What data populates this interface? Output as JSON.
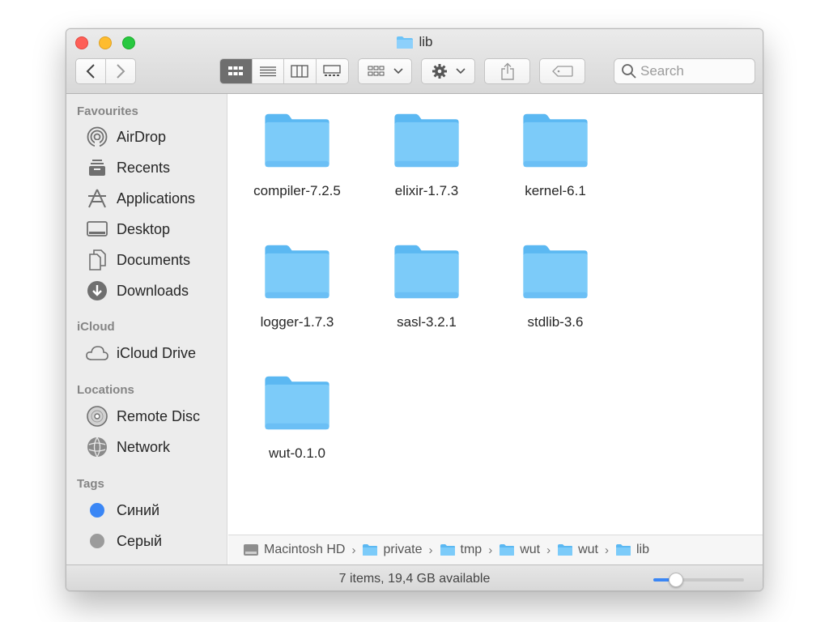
{
  "window": {
    "title": "lib"
  },
  "toolbar": {
    "search_placeholder": "Search"
  },
  "sidebar": {
    "sections": [
      {
        "title": "Favourites",
        "items": [
          {
            "label": "AirDrop",
            "icon": "airdrop-icon"
          },
          {
            "label": "Recents",
            "icon": "recents-icon"
          },
          {
            "label": "Applications",
            "icon": "applications-icon"
          },
          {
            "label": "Desktop",
            "icon": "desktop-icon"
          },
          {
            "label": "Documents",
            "icon": "documents-icon"
          },
          {
            "label": "Downloads",
            "icon": "downloads-icon"
          }
        ]
      },
      {
        "title": "iCloud",
        "items": [
          {
            "label": "iCloud Drive",
            "icon": "cloud-icon"
          }
        ]
      },
      {
        "title": "Locations",
        "items": [
          {
            "label": "Remote Disc",
            "icon": "disc-icon"
          },
          {
            "label": "Network",
            "icon": "network-icon"
          }
        ]
      },
      {
        "title": "Tags",
        "items": [
          {
            "label": "Синий",
            "color": "#3a86f5"
          },
          {
            "label": "Серый",
            "color": "#9b9b9b"
          }
        ]
      }
    ]
  },
  "files": [
    {
      "name": "compiler-7.2.5"
    },
    {
      "name": "elixir-1.7.3"
    },
    {
      "name": "kernel-6.1"
    },
    {
      "name": "logger-1.7.3"
    },
    {
      "name": "sasl-3.2.1"
    },
    {
      "name": "stdlib-3.6"
    },
    {
      "name": "wut-0.1.0"
    }
  ],
  "pathbar": {
    "crumbs": [
      "Macintosh HD",
      "private",
      "tmp",
      "wut",
      "wut",
      "lib"
    ]
  },
  "status": {
    "text": "7 items, 19,4 GB available",
    "icon_size_fraction": 0.25
  },
  "colors": {
    "folder_top": "#8dd0fb",
    "folder_body": "#6cc3f7",
    "accent": "#3a86f5"
  }
}
